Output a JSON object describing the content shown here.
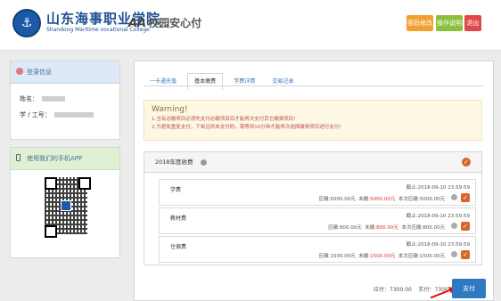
{
  "header": {
    "logo_emblem": "⚓",
    "school_name": "山东海事职业学院",
    "school_name_en": "Shandong Maritime vocational College",
    "pay_logo_mark": "AA",
    "pay_logo_text": "校园安心付",
    "buttons": {
      "change": "密码修改",
      "help": "操作说明",
      "exit": "退出"
    },
    "colors": {
      "change": "#f0a030",
      "help": "#8cc03c",
      "exit": "#e04848"
    }
  },
  "sidebar": {
    "login_title": "登录信息",
    "name_label": "姓名：",
    "id_label": "学 / 工号：",
    "app_title": "使用我们的手机APP",
    "qr_icon": "qr-code"
  },
  "tabs": [
    "一卡通充值",
    "基本缴费",
    "学费详情",
    "交易记录"
  ],
  "active_tab": "基本缴费",
  "warning": {
    "title": "Warning!",
    "line1": "1.当有必缴项目必须先支付必缴项目后才能再次支付其它缴费项目!",
    "line2": "2.为避免重复支付，下单且尚未支付的，需等待10分钟才能再次选择缴费项目进行支付!"
  },
  "fee_panel": {
    "title": "2018年度收费",
    "items": [
      {
        "name": "学费",
        "deadline": "截止:2018-09-10 23:59:59",
        "due_label": "应缴:",
        "due": "5000.00元",
        "unpaid_label": "未缴:",
        "unpaid": "5000.00元",
        "now_label": "本次应缴:",
        "now": "5000.00元"
      },
      {
        "name": "教材费",
        "deadline": "截止:2018-09-10 23:59:59",
        "due_label": "应缴:",
        "due": "800.00元",
        "unpaid_label": "未缴:",
        "unpaid": "800.00元",
        "now_label": "本次应缴:",
        "now": "800.00元"
      },
      {
        "name": "住宿费",
        "deadline": "截止:2018-09-10 23:59:59",
        "due_label": "应缴:",
        "due": "1500.00元",
        "unpaid_label": "未缴:",
        "unpaid": "1500.00元",
        "now_label": "本次应缴:",
        "now": "1500.00元"
      }
    ]
  },
  "totals": {
    "due_label": "应付：",
    "due": "7300.00",
    "paid_label": "实付：",
    "paid": "7300.00",
    "pay_button": "支付"
  }
}
